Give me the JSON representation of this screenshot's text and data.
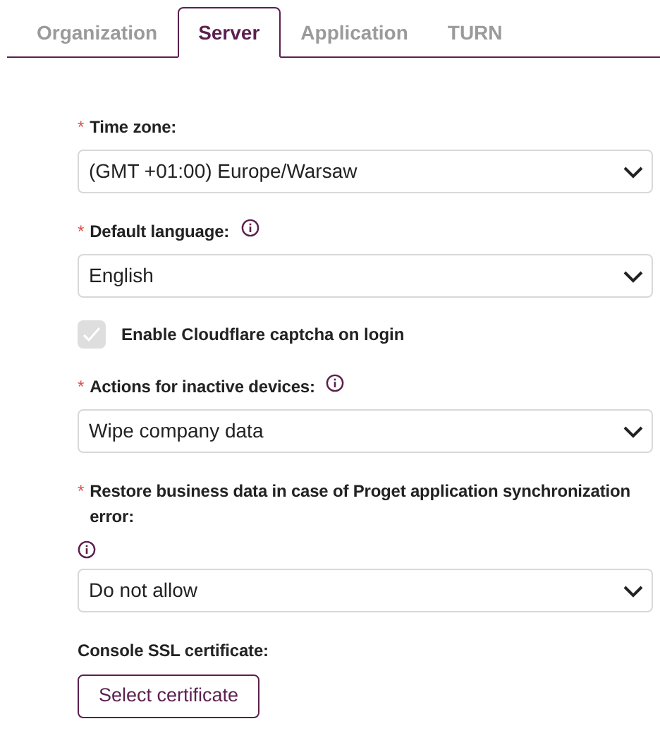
{
  "tabs": [
    {
      "label": "Organization",
      "selected": false
    },
    {
      "label": "Server",
      "selected": true
    },
    {
      "label": "Application",
      "selected": false
    },
    {
      "label": "TURN",
      "selected": false
    }
  ],
  "fields": [
    {
      "kind": "select",
      "required_mark": "*",
      "label": "Time zone:",
      "info": false,
      "value": "(GMT +01:00) Europe/Warsaw"
    },
    {
      "kind": "select",
      "required_mark": "*",
      "label": "Default language:",
      "info": true,
      "value": "English"
    },
    {
      "kind": "checkbox",
      "label": "Enable Cloudflare captcha on login",
      "checked": true,
      "disabled": true
    },
    {
      "kind": "select",
      "required_mark": "*",
      "label": "Actions for inactive devices:",
      "info": true,
      "value": "Wipe company data"
    },
    {
      "kind": "select",
      "required_mark": "*",
      "label": "Restore business data in case of Proget application synchronization error:",
      "info": true,
      "value": "Do not allow"
    },
    {
      "kind": "button",
      "label": "Console SSL certificate:",
      "info": false,
      "value": "Select certificate"
    }
  ]
}
